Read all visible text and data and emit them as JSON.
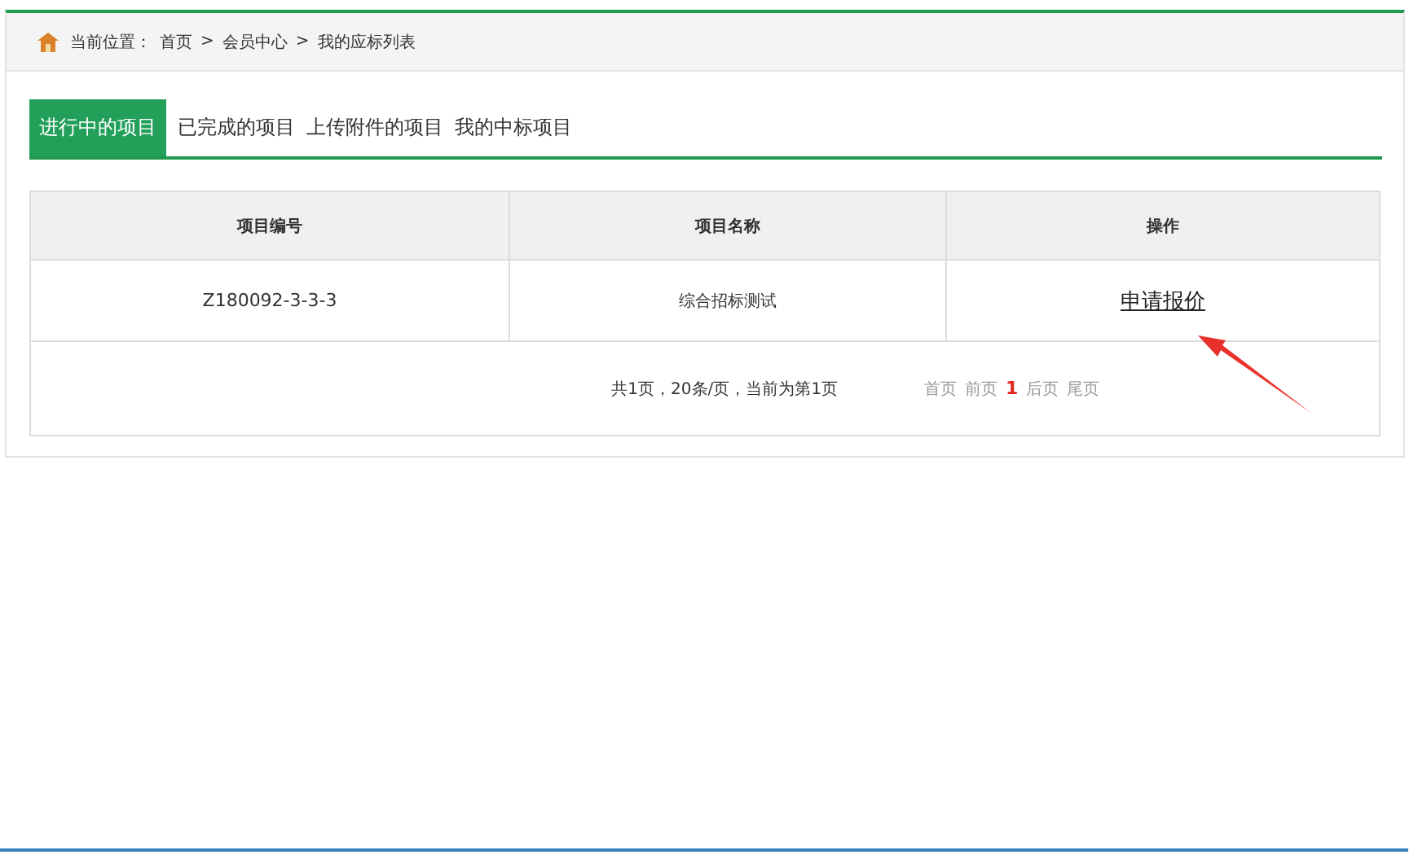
{
  "breadcrumb": {
    "label": "当前位置：",
    "items": [
      "首页",
      "会员中心",
      "我的应标列表"
    ],
    "separator": ">"
  },
  "tabs": [
    {
      "label": "进行中的项目",
      "selected": true
    },
    {
      "label": "已完成的项目",
      "selected": false
    },
    {
      "label": "上传附件的项目",
      "selected": false
    },
    {
      "label": "我的中标项目",
      "selected": false
    }
  ],
  "table": {
    "columns": [
      "项目编号",
      "项目名称",
      "操作"
    ],
    "rows": [
      {
        "code": "Z180092-3-3-3",
        "name": "综合招标测试",
        "action": "申请报价"
      }
    ]
  },
  "pagination": {
    "summary": "共1页，20条/页，当前为第1页",
    "pages": [
      {
        "label": "首页",
        "selected": false
      },
      {
        "label": "前页",
        "selected": false
      },
      {
        "label": "1",
        "selected": true
      },
      {
        "label": "后页",
        "selected": false
      },
      {
        "label": "尾页",
        "selected": false
      }
    ]
  }
}
